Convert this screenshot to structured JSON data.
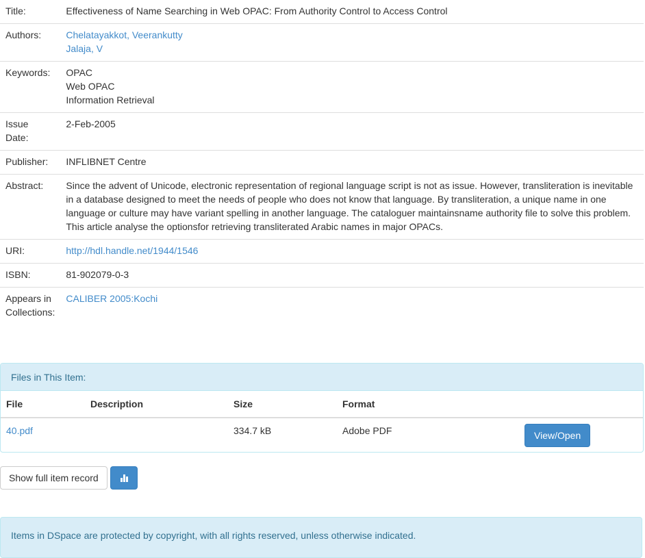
{
  "metadata": {
    "title_label": "Title:",
    "title": "Effectiveness of Name Searching in Web OPAC: From Authority Control to Access Control",
    "authors_label": "Authors:",
    "authors": [
      "Chelatayakkot, Veerankutty",
      "Jalaja, V"
    ],
    "keywords_label": "Keywords:",
    "keywords": [
      "OPAC",
      "Web OPAC",
      "Information Retrieval"
    ],
    "issue_date_label_1": "Issue",
    "issue_date_label_2": "Date:",
    "issue_date": "2-Feb-2005",
    "publisher_label": "Publisher:",
    "publisher": "INFLIBNET Centre",
    "abstract_label": "Abstract:",
    "abstract": "Since the advent of Unicode, electronic representation of regional language script is not as issue. However, transliteration is inevitable in a database designed to meet the needs of people who does not know that language. By transliteration, a unique name in one language or culture may have variant spelling in another language. The cataloguer maintainsname authority file to solve this problem. This article analyse the optionsfor retrieving transliterated Arabic names in major OPACs.",
    "uri_label": "URI:",
    "uri": "http://hdl.handle.net/1944/1546",
    "isbn_label": "ISBN:",
    "isbn": "81-902079-0-3",
    "collections_label_1": "Appears in",
    "collections_label_2": "Collections:",
    "collection": "CALIBER 2005:Kochi"
  },
  "files": {
    "heading": "Files in This Item:",
    "columns": [
      "File",
      "Description",
      "Size",
      "Format"
    ],
    "rows": [
      {
        "file": "40.pdf",
        "description": "",
        "size": "334.7 kB",
        "format": "Adobe PDF",
        "action": "View/Open"
      }
    ]
  },
  "actions": {
    "full_record": "Show full item record",
    "stats_icon": "bar-chart-icon"
  },
  "footer": {
    "text": "Items in DSpace are protected by copyright, with all rights reserved, unless otherwise indicated."
  },
  "colors": {
    "link": "#428bca",
    "info_bg": "#d9edf7",
    "info_text": "#31708f"
  }
}
